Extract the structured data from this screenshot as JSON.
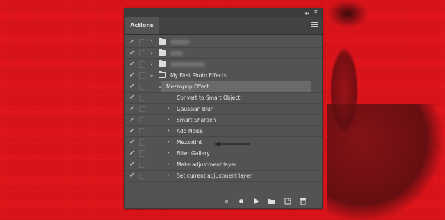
{
  "panel": {
    "tab_label": "Actions",
    "title_bar": {
      "collapse_glyph": "◂◂",
      "close_glyph": "✕"
    },
    "menu_icon": "hamburger-menu-icon"
  },
  "actions": {
    "rows": [
      {
        "kind": "set",
        "label": "",
        "blurred": true,
        "expanded": false,
        "checked": true
      },
      {
        "kind": "set",
        "label": "",
        "blurred": true,
        "expanded": false,
        "checked": true
      },
      {
        "kind": "set",
        "label": "",
        "blurred": true,
        "expanded": false,
        "checked": true
      },
      {
        "kind": "set",
        "label": "My First Photo Effects",
        "blurred": false,
        "expanded": true,
        "checked": true
      },
      {
        "kind": "action",
        "label": "Mezzopop Effect",
        "expanded": true,
        "checked": true,
        "selected": true
      },
      {
        "kind": "step",
        "label": "Convert to Smart Object",
        "has_arrow": false,
        "checked": true
      },
      {
        "kind": "step",
        "label": "Gaussian Blur",
        "has_arrow": true,
        "checked": true
      },
      {
        "kind": "step",
        "label": "Smart Sharpen",
        "has_arrow": true,
        "checked": true
      },
      {
        "kind": "step",
        "label": "Add Noise",
        "has_arrow": true,
        "checked": true
      },
      {
        "kind": "step",
        "label": "Mezzotint",
        "has_arrow": true,
        "checked": true
      },
      {
        "kind": "step",
        "label": "Filter Gallery",
        "has_arrow": true,
        "checked": true,
        "annotated": true
      },
      {
        "kind": "step",
        "label": "Make adjustment layer",
        "has_arrow": true,
        "checked": true
      },
      {
        "kind": "step",
        "label": "Set current adjustment layer",
        "has_arrow": true,
        "checked": true
      }
    ]
  },
  "bottom_bar": {
    "buttons": [
      {
        "name": "stop-icon",
        "glyph": "■"
      },
      {
        "name": "record-icon",
        "glyph": "●"
      },
      {
        "name": "play-icon",
        "glyph": "▶"
      },
      {
        "name": "new-set-folder-icon",
        "glyph": ""
      },
      {
        "name": "new-action-icon",
        "glyph": ""
      },
      {
        "name": "trash-icon",
        "glyph": ""
      }
    ]
  },
  "colors": {
    "background_red": "#e0141b",
    "panel_gray": "#535353",
    "selected_row": "#6a6a6a",
    "text": "#e6e6e6"
  }
}
